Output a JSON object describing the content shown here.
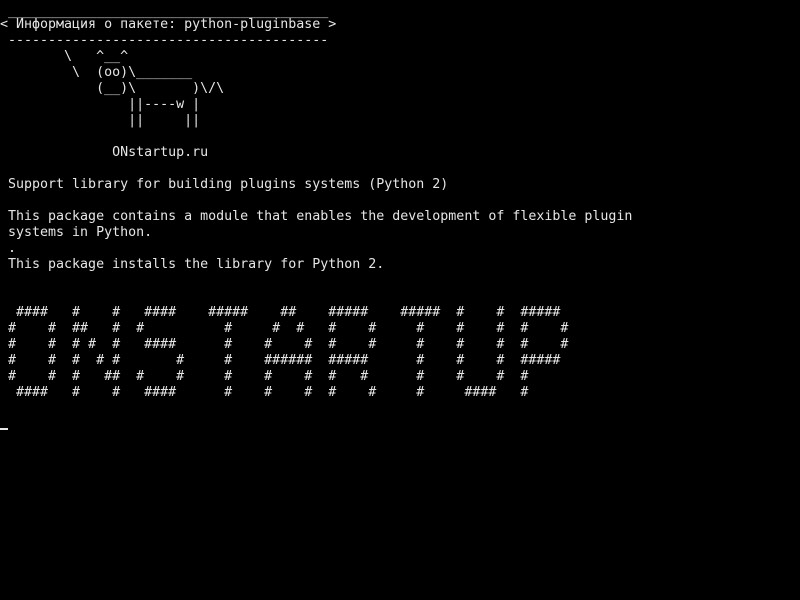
{
  "terminal": {
    "bg": "#000000",
    "fg": "#e6e6e6",
    "lines": [
      " ________________________________________",
      "< Информация о пакете: python-pluginbase >",
      " ----------------------------------------",
      "        \\   ^__^",
      "         \\  (oo)\\_______",
      "            (__)\\       )\\/\\",
      "                ||----w |",
      "                ||     ||",
      "",
      "              ONstartup.ru",
      "",
      " Support library for building plugins systems (Python 2)",
      "",
      " This package contains a module that enables the development of flexible plugin",
      " systems in Python.",
      " .",
      " This package installs the library for Python 2.",
      "",
      "",
      "  ####   #    #   ####    #####    ##    #####    #####  #    #  #####",
      " #    #  ##   #  #          #     #  #   #    #     #    #    #  #    #",
      " #    #  # #  #   ####      #    #    #  #    #     #    #    #  #    #",
      " #    #  #  # #       #     #    ######  #####      #    #    #  #####",
      " #    #  #   ##  #    #     #    #    #  #   #      #    #    #  #",
      "  ####   #    #   ####      #    #    #  #    #     #     ####   #"
    ]
  }
}
